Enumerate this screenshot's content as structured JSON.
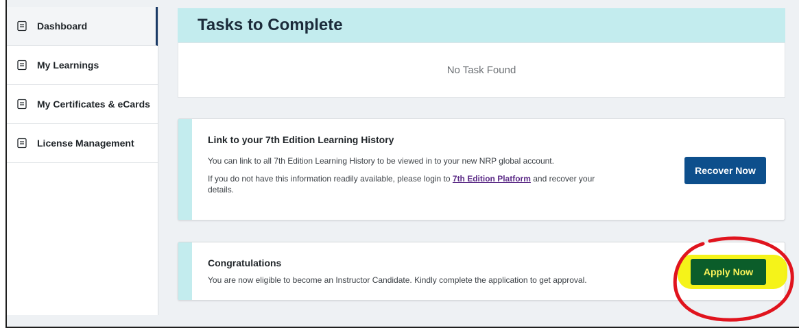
{
  "sidebar": {
    "items": [
      {
        "label": "Dashboard",
        "icon": "document-icon",
        "active": true
      },
      {
        "label": "My Learnings",
        "icon": "document-icon"
      },
      {
        "label": "My Certificates & eCards",
        "icon": "document-icon"
      },
      {
        "label": "License Management",
        "icon": "document-icon"
      }
    ]
  },
  "tasks": {
    "title": "Tasks to Complete",
    "empty_text": "No Task Found"
  },
  "link_card": {
    "title": "Link to your 7th Edition Learning History",
    "line1": "You can link to all 7th Edition Learning History to be viewed in to your new NRP global account.",
    "line2_prefix": "If you do not have this information readily available, please login to ",
    "line2_link": "7th Edition Platform",
    "line2_suffix": " and recover your",
    "line3": "details.",
    "button": "Recover Now"
  },
  "congrats_card": {
    "title": "Congratulations",
    "text": "You are now eligible to become an Instructor Candidate. Kindly complete the application to get approval.",
    "button": "Apply Now"
  },
  "colors": {
    "accent_teal": "#c3ecee",
    "primary_button": "#0d4f8c",
    "apply_button": "#0b5d2a",
    "highlight": "#f4f200",
    "annotation_red": "#e0141e"
  }
}
